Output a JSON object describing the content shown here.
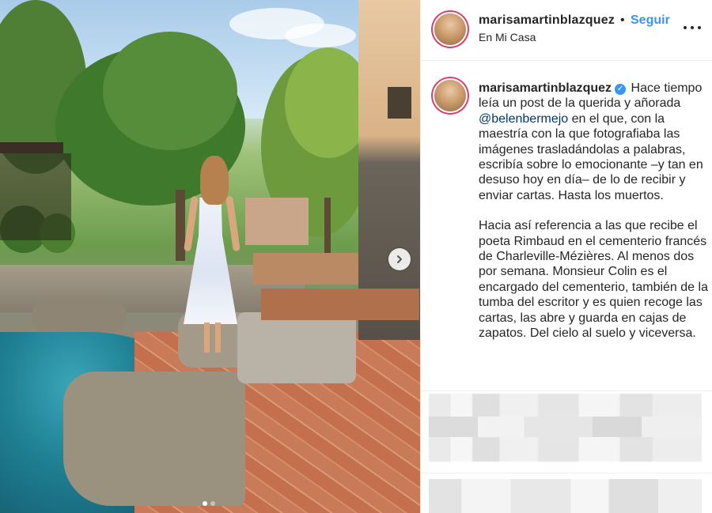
{
  "post": {
    "photo": {
      "carousel_index": 1,
      "carousel_total": 2,
      "next_icon": "chevron-right-icon"
    },
    "header": {
      "username": "marisamartinblazquez",
      "separator": "•",
      "follow_label": "Seguir",
      "location": "En Mi Casa",
      "more_icon": "more-horizontal-icon"
    },
    "caption": {
      "username": "marisamartinblazquez",
      "verified_icon": "verified-badge-icon",
      "verified_glyph": "✓",
      "para1_a": "Hace tiempo leía un post de la querida y añorada",
      "mention": "@belenbermejo",
      "para1_b": "en el que, con la maestría con la que fotografiaba las imágenes trasladándolas a palabras, escribía sobre lo emocionante –y tan en desuso hoy en día– de lo de recibir y enviar cartas. Hasta los muertos.",
      "para2": "Hacia así referencia a las que recibe el poeta Rimbaud en el cementerio francés de Charleville-Mézières. Al menos dos por semana. Monsieur Colin es el encargado del cementerio, también de la tumba del escritor y es quien recoge las cartas, las abre y guarda en cajas de zapatos. Del cielo al suelo y viceversa."
    },
    "colors": {
      "follow": "#3897f0",
      "text": "#262626",
      "mention": "#00376b",
      "avatar_ring": "#d7406b"
    }
  }
}
